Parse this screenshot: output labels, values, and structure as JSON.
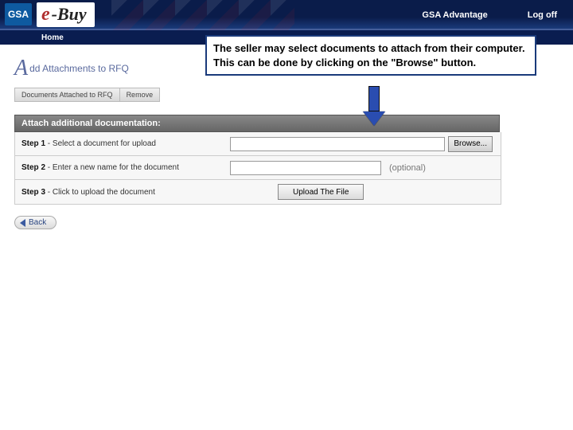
{
  "header": {
    "gsa_logo": "GSA",
    "ebuy_e": "e",
    "ebuy_buy": "-Buy",
    "nav_right": {
      "advantage": "GSA Advantage",
      "logoff": "Log off"
    },
    "subnav_home": "Home"
  },
  "page_title": {
    "A": "A",
    "rest": "dd Attachments to RFQ"
  },
  "attached_bar": {
    "docs": "Documents Attached to RFQ",
    "remove": "Remove"
  },
  "attach_section": {
    "header": "Attach additional documentation:",
    "step1": {
      "bold": "Step 1",
      "text": " - Select a document for upload",
      "browse": "Browse..."
    },
    "step2": {
      "bold": "Step 2",
      "text": " - Enter a new name for the document",
      "optional": "(optional)"
    },
    "step3": {
      "bold": "Step 3",
      "text": " - Click to upload the document",
      "upload": "Upload The File"
    }
  },
  "back_label": "Back",
  "callout_text": "The seller may select documents to attach from their computer.  This can be done by clicking on the \"Browse\" button."
}
